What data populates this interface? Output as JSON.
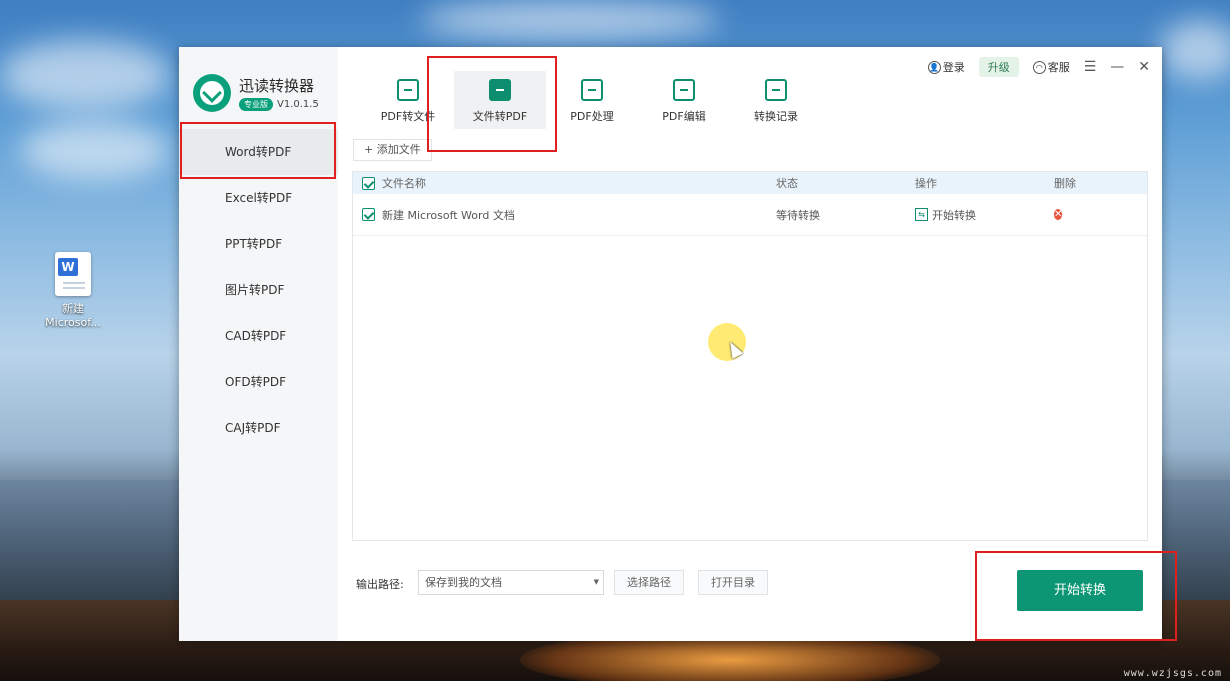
{
  "desktop": {
    "icon_label_line1": "新建",
    "icon_label_line2": "Microsof...",
    "icon_glyph": "W",
    "watermark": "www.wzjsgs.com"
  },
  "app": {
    "title": "迅读转换器",
    "edition_badge": "专业版",
    "version": "V1.0.1.5",
    "accent_color": "#0d9674"
  },
  "header": {
    "tabs": [
      {
        "label": "PDF转文件",
        "icon": "pdf-export-icon"
      },
      {
        "label": "文件转PDF",
        "icon": "file-import-icon",
        "active": true
      },
      {
        "label": "PDF处理",
        "icon": "pdf-process-icon"
      },
      {
        "label": "PDF编辑",
        "icon": "pdf-edit-icon"
      },
      {
        "label": "转换记录",
        "icon": "history-icon"
      }
    ],
    "login": "登录",
    "upgrade": "升级",
    "service": "客服",
    "menu_glyph": "☰",
    "minimize_glyph": "—",
    "close_glyph": "✕"
  },
  "sidebar": {
    "items": [
      {
        "label": "Word转PDF",
        "active": true
      },
      {
        "label": "Excel转PDF"
      },
      {
        "label": "PPT转PDF"
      },
      {
        "label": "图片转PDF"
      },
      {
        "label": "CAD转PDF"
      },
      {
        "label": "OFD转PDF"
      },
      {
        "label": "CAJ转PDF"
      }
    ]
  },
  "main": {
    "add_file": "+ 添加文件",
    "columns": {
      "name": "文件名称",
      "status": "状态",
      "operation": "操作",
      "delete": "删除"
    },
    "rows": [
      {
        "name": "新建 Microsoft Word 文档",
        "status": "等待转换",
        "operation": "开始转换"
      }
    ]
  },
  "footer": {
    "output_label": "输出路径:",
    "output_path": "保存到我的文档",
    "choose_path": "选择路径",
    "open_dir": "打开目录",
    "start": "开始转换"
  }
}
